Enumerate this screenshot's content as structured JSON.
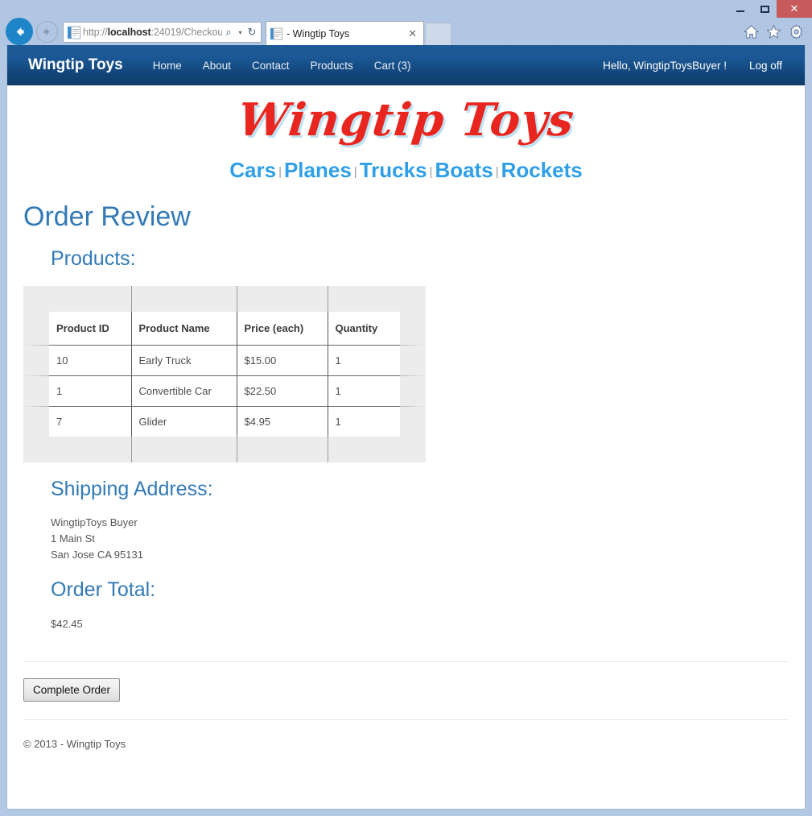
{
  "browser": {
    "window_controls": {
      "minimize": "minimize",
      "maximize": "maximize",
      "close": "✕"
    },
    "back_label": "Back",
    "forward_label": "Forward",
    "address": {
      "scheme": "http://",
      "host": "localhost",
      "rest": ":24019/Checkou",
      "full": "http://localhost:24019/Checkou",
      "search_icon": "search-icon",
      "dropdown_icon": "chevron-down-icon",
      "refresh_icon": "refresh-icon",
      "refresh_glyph": "↻",
      "search_glyph": "⌕",
      "caret_glyph": "▾"
    },
    "tab": {
      "title": "- Wingtip Toys",
      "close_glyph": "✕"
    },
    "new_tab_label": "",
    "toolbar_icons": [
      "home-icon",
      "favorites-star-icon",
      "settings-gear-icon"
    ]
  },
  "navbar": {
    "brand": "Wingtip Toys",
    "links": [
      {
        "label": "Home"
      },
      {
        "label": "About"
      },
      {
        "label": "Contact"
      },
      {
        "label": "Products"
      },
      {
        "label": "Cart (3)"
      }
    ],
    "greeting": "Hello, WingtipToysBuyer !",
    "logoff": "Log off"
  },
  "branding": {
    "logo_text": "Wingtip Toys",
    "logo_color": "#e8261f",
    "logo_shadow_color": "#bfe2f2"
  },
  "categories": {
    "separator": "|",
    "items": [
      {
        "label": "Cars"
      },
      {
        "label": "Planes"
      },
      {
        "label": "Trucks"
      },
      {
        "label": "Boats"
      },
      {
        "label": "Rockets"
      }
    ],
    "link_color": "#2f9fe8"
  },
  "main": {
    "title": "Order Review",
    "accent_color": "#337ab7",
    "products_heading": "Products:",
    "table": {
      "columns": [
        "Product ID",
        "Product Name",
        "Price (each)",
        "Quantity"
      ],
      "rows": [
        [
          "10",
          "Early Truck",
          "$15.00",
          "1"
        ],
        [
          "1",
          "Convertible Car",
          "$22.50",
          "1"
        ],
        [
          "7",
          "Glider",
          "$4.95",
          "1"
        ]
      ]
    },
    "shipping_heading": "Shipping Address:",
    "shipping_address": [
      "WingtipToys Buyer",
      "1 Main St",
      "San Jose CA 95131"
    ],
    "order_total_heading": "Order Total:",
    "order_total": "$42.45",
    "complete_order_label": "Complete Order"
  },
  "footer": {
    "text": "© 2013 - Wingtip Toys"
  }
}
